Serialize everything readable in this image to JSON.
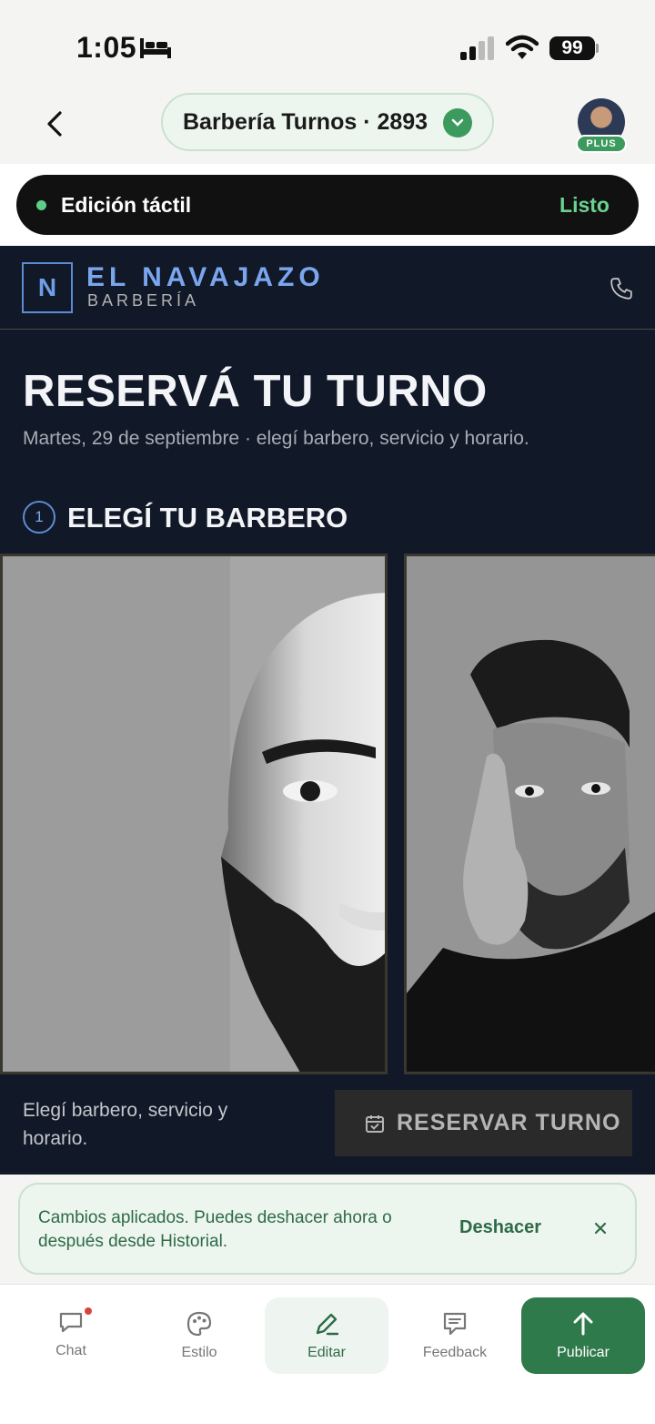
{
  "status_bar": {
    "time": "1:05",
    "battery": "99",
    "icons": [
      "bed-icon",
      "signal-icon",
      "wifi-icon",
      "battery-icon"
    ]
  },
  "top_nav": {
    "project_title": "Barbería Turnos · 2893",
    "plan_badge": "PLUS",
    "icons": [
      "back-icon",
      "chevron-down-icon",
      "avatar"
    ]
  },
  "edit_banner": {
    "label": "Edición táctil",
    "done": "Listo"
  },
  "site": {
    "logo_letter": "N",
    "brand": "EL NAVAJAZO",
    "brand_sub": "BARBERÍA",
    "hero_title": "RESERVÁ TU TURNO",
    "hero_subtitle": "Martes, 29 de septiembre · elegí barbero, servicio y horario.",
    "step_number": "1",
    "step_title": "ELEGÍ TU BARBERO",
    "booking_hint": "Elegí barbero, servicio y horario.",
    "book_button": "RESERVAR TURNO"
  },
  "toast": {
    "message": "Cambios aplicados. Puedes deshacer ahora o después desde Historial.",
    "undo": "Deshacer"
  },
  "tabs": [
    {
      "label": "Chat",
      "icon": "chat-icon"
    },
    {
      "label": "Estilo",
      "icon": "palette-icon"
    },
    {
      "label": "Editar",
      "icon": "pencil-icon"
    },
    {
      "label": "Feedback",
      "icon": "feedback-icon"
    },
    {
      "label": "Publicar",
      "icon": "arrow-up-icon"
    }
  ],
  "colors": {
    "accent_green": "#2f7a4b",
    "site_background": "#111827",
    "site_accent_blue": "#7aa6ee"
  }
}
